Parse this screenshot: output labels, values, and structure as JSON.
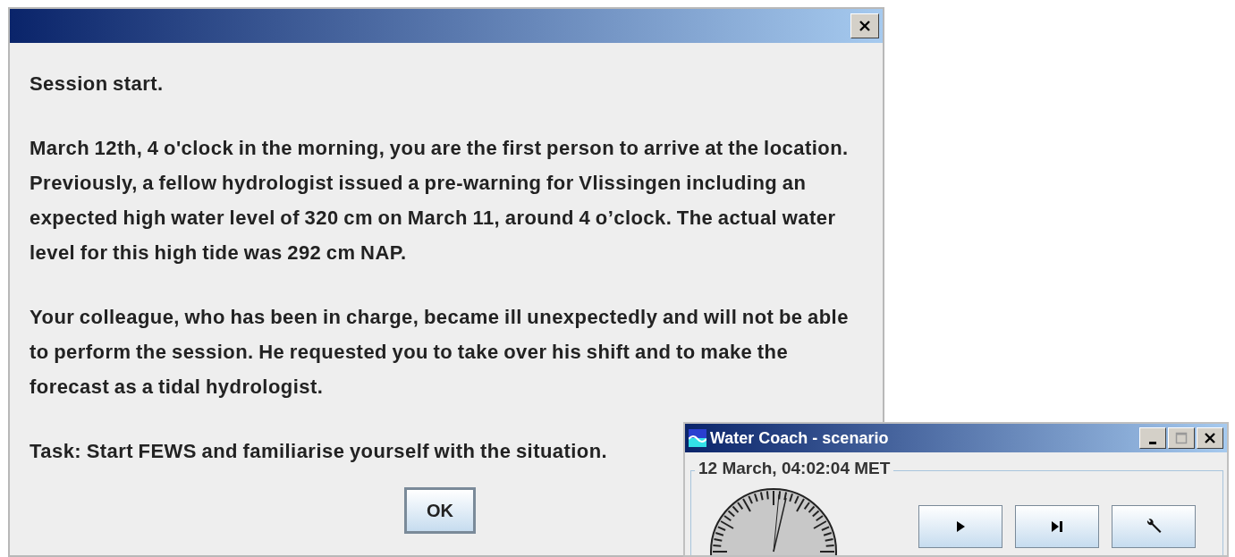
{
  "dialog": {
    "paragraphs": [
      "Session start.",
      "March 12th, 4 o'clock in the morning, you are the first person to arrive at the location. Previously, a fellow hydrologist issued a pre-warning for Vlissingen including an expected high water level of 320 cm on March 11, around 4 o’clock. The actual water level for this high tide was 292 cm NAP.",
      "Your colleague, who has been in charge, became ill unexpectedly and will not be able to perform the session. He requested you to take over his shift and to make the forecast as a tidal hydrologist.",
      "Task: Start FEWS and familiarise yourself with the situation."
    ],
    "ok_button": "OK"
  },
  "scenario_window": {
    "title": "Water Coach - scenario",
    "clock_label": "12 March, 04:02:04 MET",
    "buttons": [
      {
        "kind": "play"
      },
      {
        "kind": "step"
      },
      {
        "kind": "settings"
      }
    ]
  }
}
